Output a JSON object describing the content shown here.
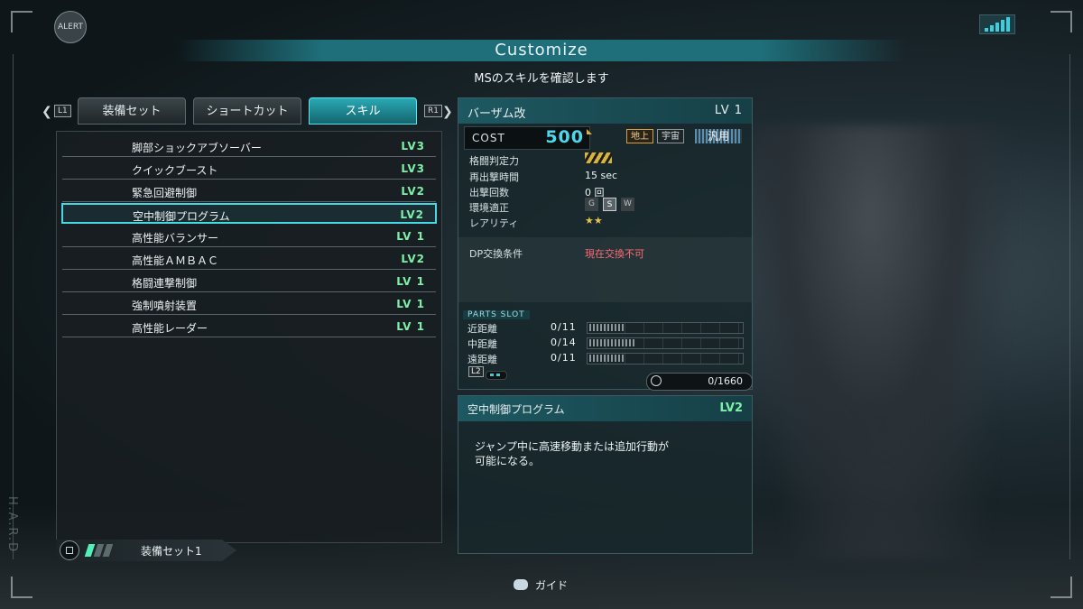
{
  "hud": {
    "alert_label": "ALERT",
    "side_text": "H.A.R.D"
  },
  "header": {
    "title": "Customize",
    "subtitle": "MSのスキルを確認します"
  },
  "tabs": {
    "left_button": "L1",
    "right_button": "R1",
    "items": [
      {
        "label": "装備セット"
      },
      {
        "label": "ショートカット"
      },
      {
        "label": "スキル"
      }
    ],
    "active_index": 2
  },
  "skills": [
    {
      "name": "脚部ショックアブソーバー",
      "level": "LV3"
    },
    {
      "name": "クイックブースト",
      "level": "LV3"
    },
    {
      "name": "緊急回避制御",
      "level": "LV2"
    },
    {
      "name": "空中制御プログラム",
      "level": "LV2"
    },
    {
      "name": "高性能バランサー",
      "level": "LV 1"
    },
    {
      "name": "高性能ＡＭＢＡＣ",
      "level": "LV2"
    },
    {
      "name": "格闘連撃制御",
      "level": "LV 1"
    },
    {
      "name": "強制噴射装置",
      "level": "LV 1"
    },
    {
      "name": "高性能レーダー",
      "level": "LV 1"
    }
  ],
  "selected_skill_index": 3,
  "loadout": {
    "label": "装備セット1"
  },
  "ms": {
    "name": "バーザム改",
    "level": "LV 1",
    "cost_label": "COST",
    "cost_value": "500",
    "env_ground": "地上",
    "env_space": "宇宙",
    "env_general": "汎用",
    "stats": [
      {
        "label": "格闘判定力",
        "value": ""
      },
      {
        "label": "再出撃時間",
        "value": "15 sec"
      },
      {
        "label": "出撃回数",
        "value": "0 回"
      },
      {
        "label": "環境適正",
        "value": ""
      },
      {
        "label": "レアリティ",
        "value": "★★"
      }
    ],
    "env_grades": [
      "G",
      "S",
      "W"
    ],
    "dp_label": "DP交換条件",
    "dp_value": "現在交換不可",
    "parts_title": "PARTS SLOT",
    "parts": [
      {
        "label": "近距離",
        "value": "0/11",
        "fill": 0.0
      },
      {
        "label": "中距離",
        "value": "0/14",
        "fill": 0.0
      },
      {
        "label": "遠距離",
        "value": "0/11",
        "fill": 0.0
      }
    ],
    "l2_label": "L2",
    "capacity": "0/1660"
  },
  "description": {
    "title": "空中制御プログラム",
    "level": "LV2",
    "text": "ジャンプ中に高速移動または追加行動が\n可能になる。"
  },
  "footer": {
    "guide_label": "ガイド"
  }
}
